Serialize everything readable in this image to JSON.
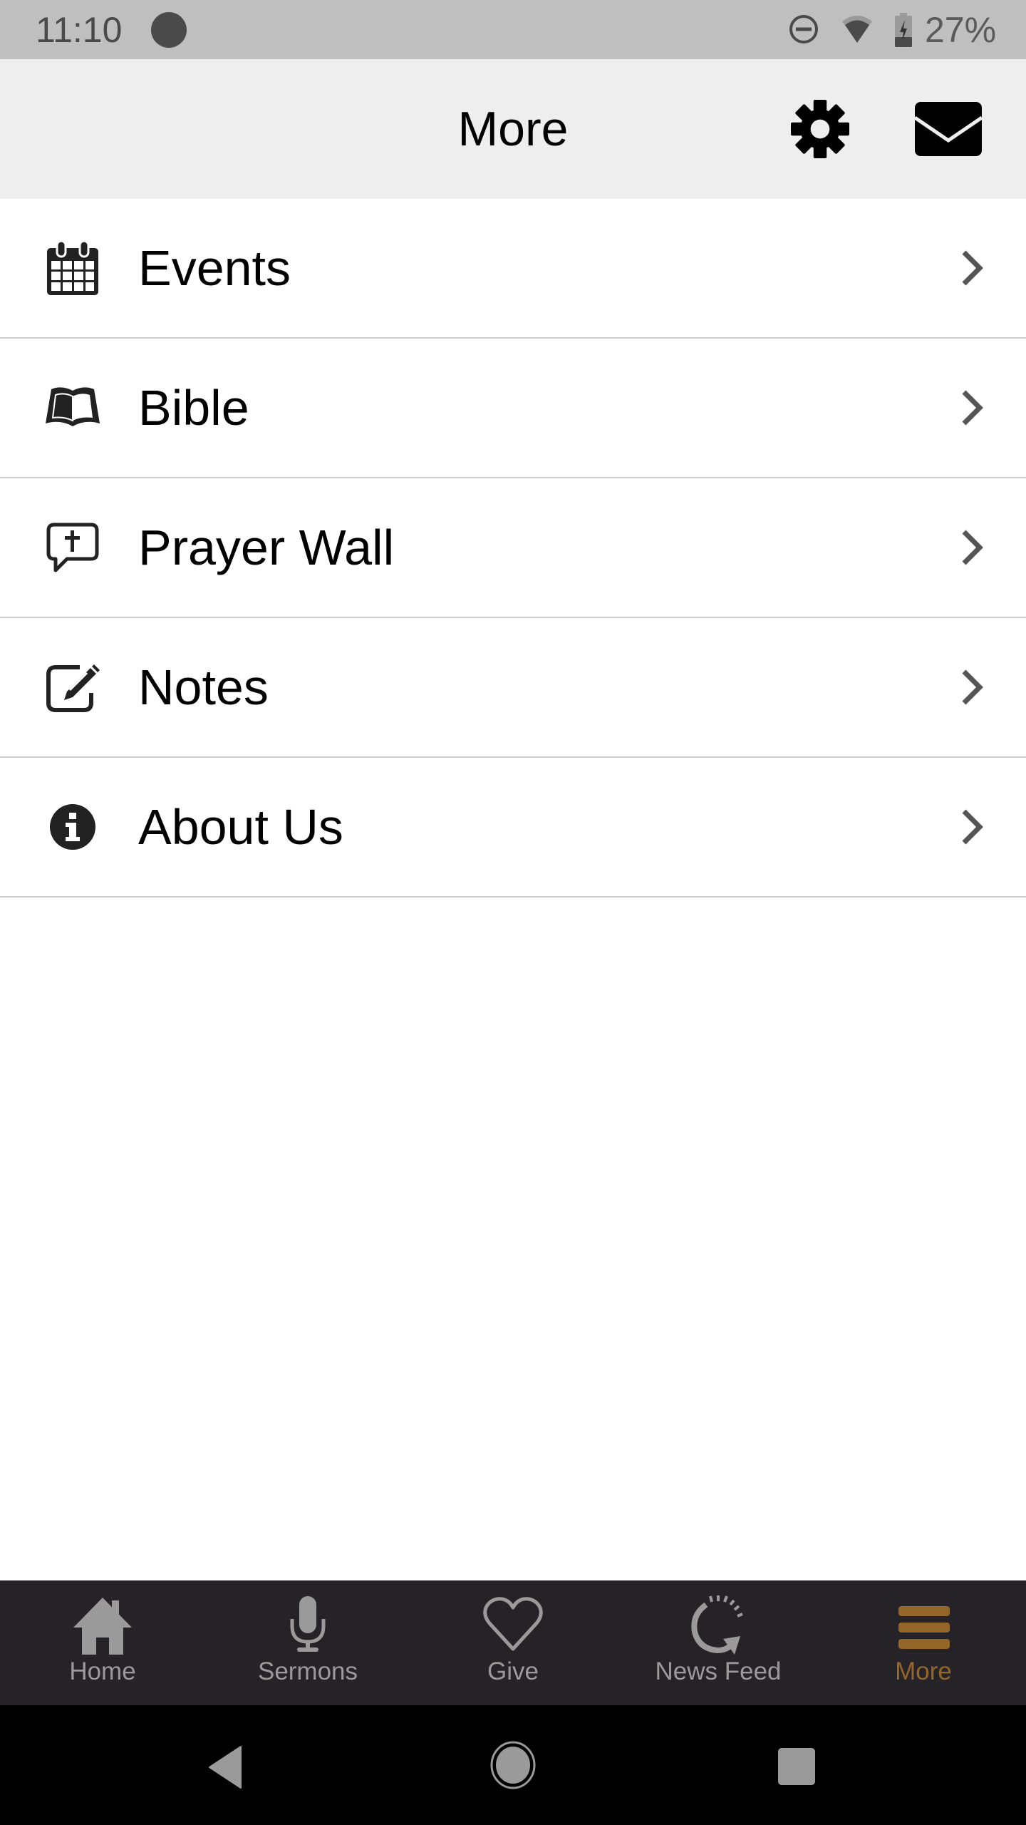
{
  "status_bar": {
    "time": "11:10",
    "battery_percent": "27%",
    "icons": [
      "notification-dot-icon",
      "do-not-disturb-icon",
      "wifi-icon",
      "battery-charging-icon"
    ]
  },
  "header": {
    "title": "More",
    "settings_icon": "gear-icon",
    "messages_icon": "envelope-icon"
  },
  "menu": {
    "items": [
      {
        "label": "Events",
        "icon": "calendar-icon"
      },
      {
        "label": "Bible",
        "icon": "open-book-icon"
      },
      {
        "label": "Prayer Wall",
        "icon": "speech-bubble-cross-icon"
      },
      {
        "label": "Notes",
        "icon": "edit-note-icon"
      },
      {
        "label": "About Us",
        "icon": "info-icon"
      }
    ]
  },
  "tab_bar": {
    "active_color": "#946628",
    "inactive_color": "#9a9a9a",
    "tabs": [
      {
        "label": "Home",
        "icon": "home-icon",
        "active": false
      },
      {
        "label": "Sermons",
        "icon": "microphone-icon",
        "active": false
      },
      {
        "label": "Give",
        "icon": "heart-icon",
        "active": false
      },
      {
        "label": "News Feed",
        "icon": "refresh-feed-icon",
        "active": false
      },
      {
        "label": "More",
        "icon": "hamburger-menu-icon",
        "active": true
      }
    ]
  },
  "system_nav": {
    "buttons": [
      "back",
      "home",
      "recents"
    ]
  }
}
